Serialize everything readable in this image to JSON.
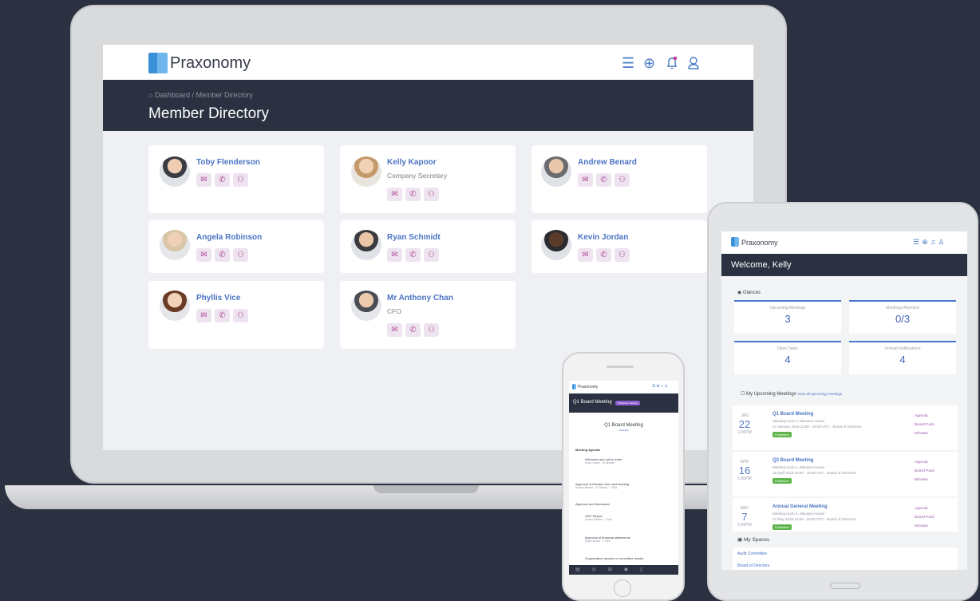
{
  "brand": "Praxonomy",
  "laptop": {
    "breadcrumb": {
      "home": "Dashboard",
      "separator": "/",
      "current": "Member Directory"
    },
    "page_title": "Member Directory",
    "members": [
      {
        "name": "Toby Flenderson",
        "role": ""
      },
      {
        "name": "Kelly Kapoor",
        "role": "Company Secretary"
      },
      {
        "name": "Andrew Benard",
        "role": ""
      },
      {
        "name": "Angela Robinson",
        "role": ""
      },
      {
        "name": "Ryan Schmidt",
        "role": ""
      },
      {
        "name": "Kevin Jordan",
        "role": ""
      },
      {
        "name": "Phyllis Vice",
        "role": ""
      },
      {
        "name": "Mr Anthony Chan",
        "role": "CFO"
      }
    ]
  },
  "tablet": {
    "welcome": "Welcome, Kelly",
    "glances_title": "Glances",
    "glances": [
      {
        "label": "Upcoming Meetings",
        "value": "3"
      },
      {
        "label": "Meetings Attended",
        "value": "0/3"
      },
      {
        "label": "Open Tasks",
        "value": "4"
      },
      {
        "label": "Unread Notifications",
        "value": "4"
      }
    ],
    "upcoming_title": "My Upcoming Meetings",
    "upcoming_link": "View all upcoming meetings",
    "meetings": [
      {
        "month": "JAN",
        "day": "22",
        "time": "1:00PM",
        "title": "Q1 Board Meeting",
        "location": "Meeting room A, Mansion House",
        "when": "22 January 2019 11:00 - 19:00 UTC",
        "group": "Board of Directors",
        "status": "Published",
        "links": [
          "Agenda",
          "Board Pack",
          "Minutes"
        ]
      },
      {
        "month": "APR",
        "day": "16",
        "time": "1:00PM",
        "title": "Q2 Board Meeting",
        "location": "Meeting room A, Mansion House",
        "when": "16 April 2019 13:00 - 18:00 UTC",
        "group": "Board of Directors",
        "status": "Published",
        "links": [
          "Agenda",
          "Board Pack",
          "Minutes"
        ]
      },
      {
        "month": "MAY",
        "day": "7",
        "time": "1:00PM",
        "title": "Annual General Meeting",
        "location": "Meeting room A, Mansion House",
        "when": "07 May 2019 13:00 - 18:00 UTC",
        "group": "Board of Directors",
        "status": "Published",
        "links": [
          "Agenda",
          "Board Pack",
          "Minutes"
        ]
      }
    ],
    "spaces_title": "My Spaces",
    "spaces": [
      "Audit Committee",
      "Board of Directors"
    ]
  },
  "phone": {
    "header": "Q1 Board Meeting",
    "badge": "Published meeting",
    "doc_title": "Q1 Board Meeting",
    "doc_sub": "AGENDA",
    "section": "Meeting Agenda",
    "items": [
      {
        "title": "Welcome and call to order",
        "sub": "Andy Cooper · 15 Minutes"
      },
      {
        "title": "Approval of Minutes from last meeting",
        "sub": "Andrew Benard · 10 Minutes · 1 Files"
      },
      {
        "title": "Approval and discussion",
        "sub": ""
      },
      {
        "title": "CEO Report",
        "sub": "Andrew Benard · 1 Files"
      },
      {
        "title": "Approval of financial statements",
        "sub": "Ryan Howard · 1 Files"
      },
      {
        "title": "Organization reports or committee results",
        "sub": ""
      }
    ]
  }
}
